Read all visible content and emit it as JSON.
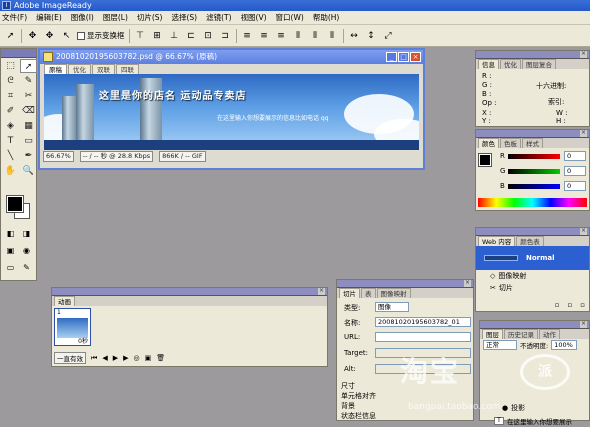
{
  "app": {
    "title": "Adobe ImageReady"
  },
  "menu": [
    "文件(F)",
    "编辑(E)",
    "图像(I)",
    "图层(L)",
    "切片(S)",
    "选择(S)",
    "滤镜(T)",
    "视图(V)",
    "窗口(W)",
    "帮助(H)"
  ],
  "options_bar": {
    "show_bounds_label": "显示变换框"
  },
  "document": {
    "title": "20081020195603782.psd @ 66.67% (原稿)",
    "tabs": [
      "原稿",
      "优化",
      "双联",
      "四联"
    ],
    "banner_heading": "这里是你的店名 运动品专卖店",
    "banner_sub": "在这里输入你想要展示的信息比如电话 qq",
    "zoom": "66.67%",
    "speed": "-- / -- 秒 @ 28.8 Kbps",
    "size": "866K / -- GIF"
  },
  "animation": {
    "title": "动画",
    "frame_num": "1",
    "frame_delay": "0秒",
    "loop": "一直有效"
  },
  "info_panel": {
    "tabs": [
      "信息",
      "优化",
      "图层复合"
    ],
    "r": "R :",
    "g": "G :",
    "b": "B :",
    "op": "Op :",
    "hex": "十六进制:",
    "index": "索引:",
    "x": "X :",
    "y": "Y :",
    "w": "W :",
    "h": "H :"
  },
  "color_panel": {
    "tabs": [
      "颜色",
      "色板",
      "样式"
    ],
    "r": "R",
    "g": "G",
    "b": "B",
    "r_val": "0",
    "g_val": "0",
    "b_val": "0"
  },
  "web_panel": {
    "tabs": [
      "Web 内容",
      "颜色表"
    ],
    "state": "Normal",
    "item1": "图像映射",
    "item2": "切片"
  },
  "slice_panel": {
    "tabs": [
      "切片",
      "表",
      "图像映射"
    ],
    "type_label": "类型:",
    "type_value": "图像",
    "name_label": "名称:",
    "name_value": "20081020195603782_01",
    "url_label": "URL:",
    "target_label": "Target:",
    "alt_label": "Alt:",
    "sections": [
      "尺寸",
      "单元格对齐",
      "背景",
      "状态栏信息"
    ]
  },
  "layers_panel": {
    "tabs": [
      "图层",
      "历史记录",
      "动作"
    ],
    "blend": "正常",
    "opacity_label": "不透明度:",
    "opacity": "100%",
    "layer1": "投影",
    "layer2": "在这里输入你想要展示"
  },
  "watermark": {
    "main": "淘宝",
    "badge": "派",
    "sub": "bangpai.taobao.com"
  }
}
